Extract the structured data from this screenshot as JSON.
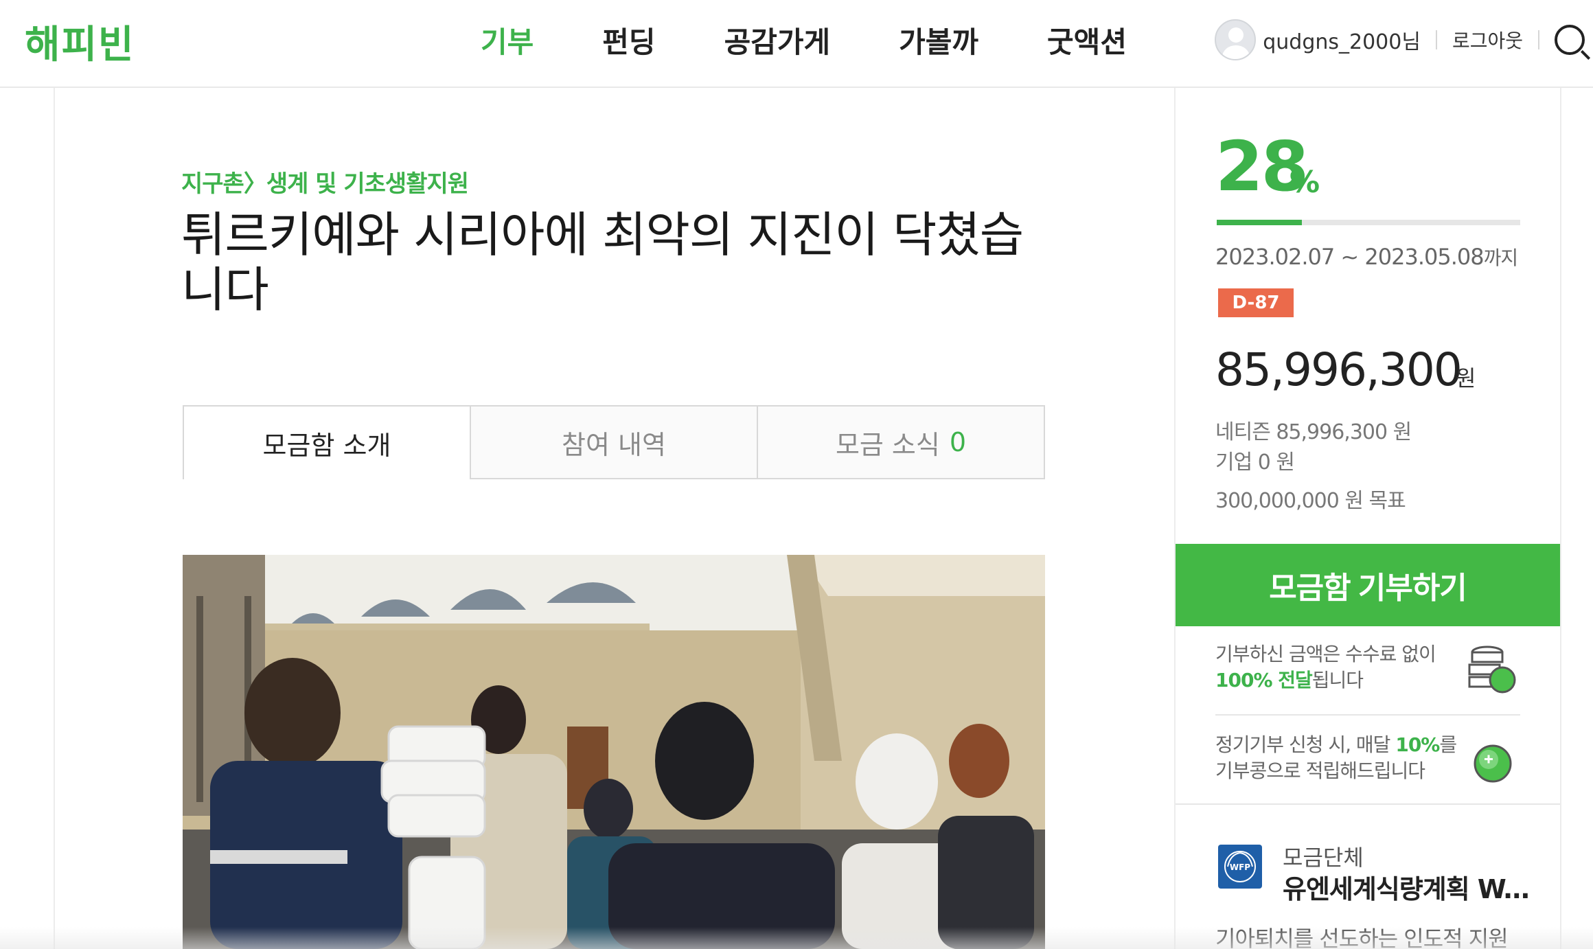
{
  "header": {
    "logo": "해피빈",
    "nav": [
      {
        "label": "기부",
        "active": true
      },
      {
        "label": "펀딩",
        "active": false
      },
      {
        "label": "공감가게",
        "active": false
      },
      {
        "label": "가볼까",
        "active": false
      },
      {
        "label": "굿액션",
        "active": false
      }
    ],
    "username": "qudgns_2000님",
    "logout": "로그아웃"
  },
  "main": {
    "breadcrumb": "지구촌〉생계 및 기초생활지원",
    "title": "튀르키예와 시리아에 최악의 지진이 닥쳤습니다",
    "tabs": [
      {
        "label": "모금함 소개",
        "active": true
      },
      {
        "label": "참여 내역",
        "active": false
      },
      {
        "label": "모금 소식",
        "count": "0",
        "active": false
      }
    ]
  },
  "side": {
    "percent": "28",
    "percent_unit": "%",
    "progress": 0.28,
    "period": "2023.02.07 ~ 2023.05.08",
    "period_suffix": "까지",
    "dday": "D-87",
    "amount": "85,996,300",
    "amount_unit": "원",
    "netizen": "네티즌 85,996,300 원",
    "company": "기업 0 원",
    "goal": "300,000,000 원 목표",
    "donate_button": "모금함 기부하기",
    "benefit1_line1": "기부하신 금액은 수수료 없이",
    "benefit1_hl": "100% 전달",
    "benefit1_rest": "됩니다",
    "benefit2_line1a": "정기기부 신청 시, 매달 ",
    "benefit2_hl": "10%",
    "benefit2_line1b": "를",
    "benefit2_line2": "기부콩으로 적립해드립니다",
    "org_label": "모금단체",
    "org_name": "유엔세계식량계획 W...",
    "org_logo_text": "WFP",
    "org_desc": "기아퇴치를 선도하는 인도적 지원",
    "accent": "#3db24b",
    "dday_color": "#eb6a4b"
  }
}
